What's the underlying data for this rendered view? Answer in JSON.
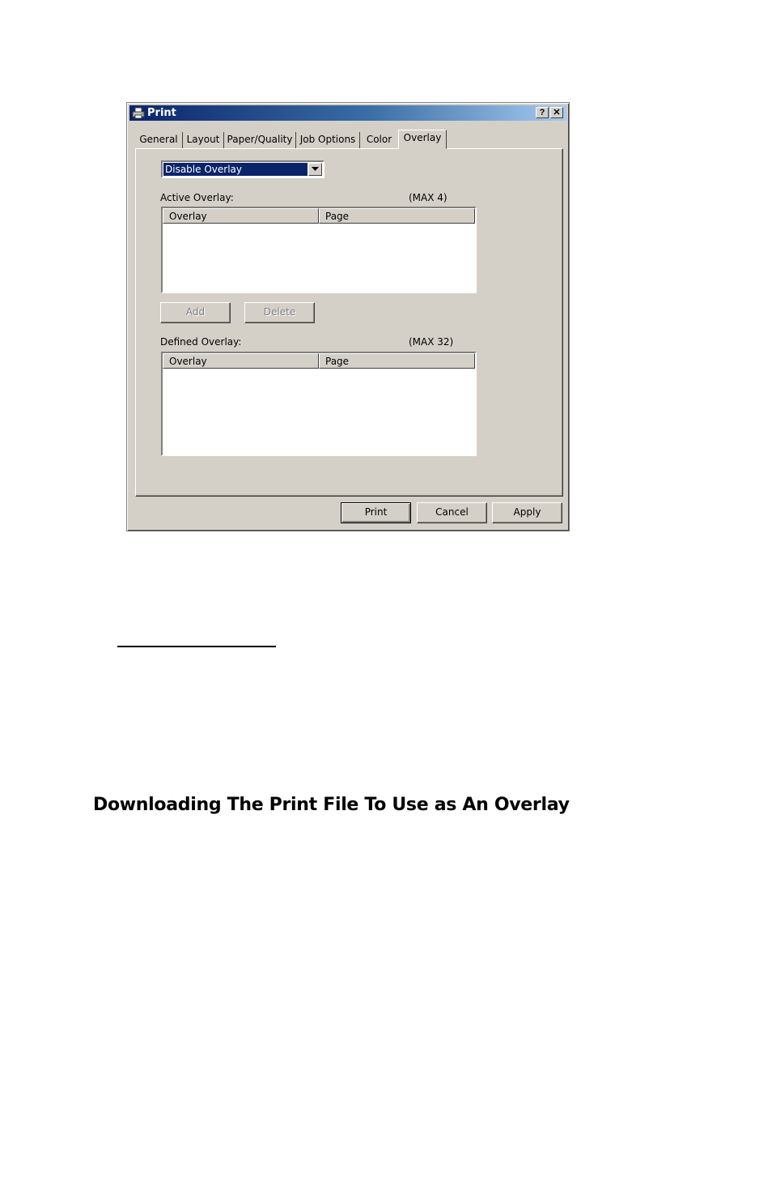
{
  "window": {
    "title": "Print",
    "help_label": "?",
    "close_label": "✕",
    "title_icon": "printer-icon"
  },
  "tabs": [
    {
      "label": "General"
    },
    {
      "label": "Layout"
    },
    {
      "label": "Paper/Quality"
    },
    {
      "label": "Job Options"
    },
    {
      "label": "Color"
    },
    {
      "label": "Overlay",
      "active": true
    }
  ],
  "overlay": {
    "mode_selected": "Disable Overlay",
    "active_label": "Active Overlay:",
    "active_max": "(MAX 4)",
    "defined_label": "Defined Overlay:",
    "defined_max": "(MAX 32)",
    "columns": [
      "Overlay",
      "Page"
    ],
    "add_label": "Add",
    "delete_label": "Delete"
  },
  "footer": {
    "print_label": "Print",
    "cancel_label": "Cancel",
    "apply_label": "Apply"
  },
  "document": {
    "heading": "Downloading The Print File To Use as An Overlay"
  },
  "colors": {
    "titlebar_start": "#0a246a",
    "titlebar_end": "#a6caf0",
    "dialog_face": "#d4d0c8"
  }
}
